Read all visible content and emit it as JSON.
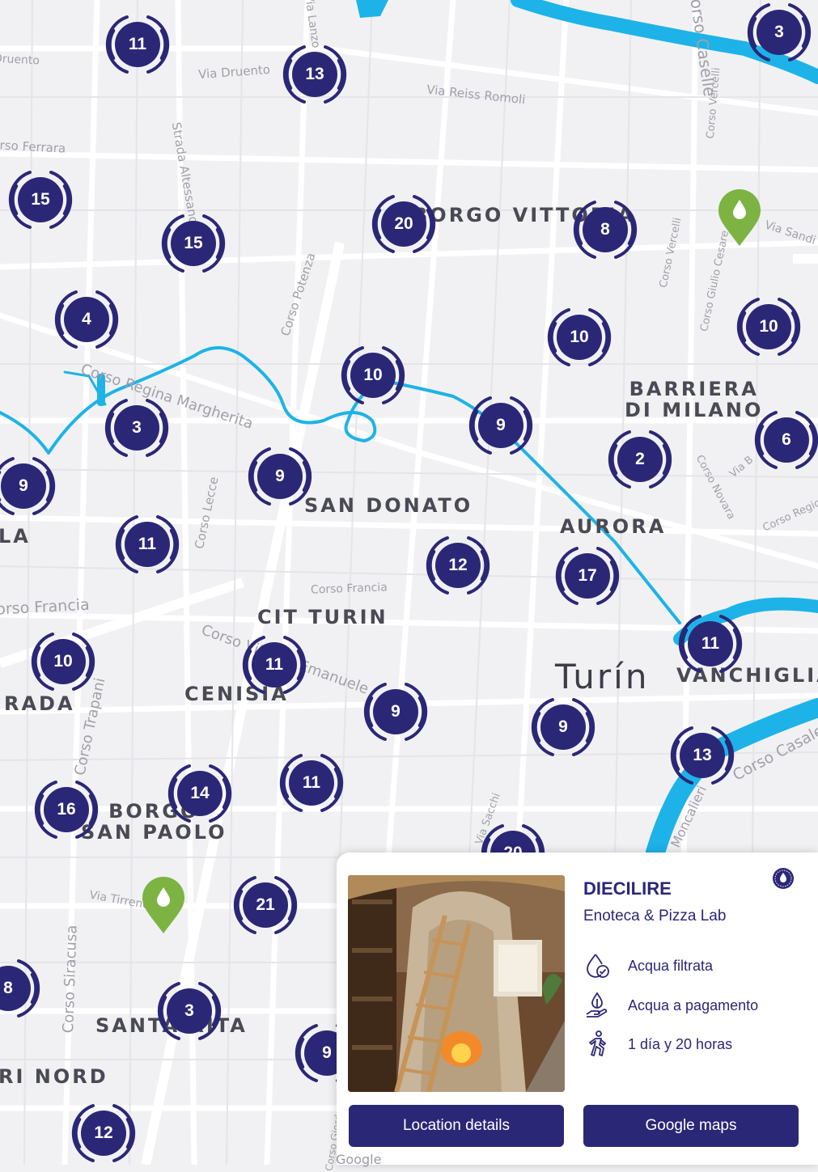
{
  "city_label": "Turín",
  "district_labels": [
    "BORGO VITTORIA",
    "BARRIERA\nDI MILANO",
    "SAN DONATO",
    "AURORA",
    "CIT TURIN",
    "CENISIA",
    "VANCHIGLIA",
    "BORGO\nSAN PAOLO",
    "SANTA RITA",
    "RADA",
    "LA",
    "RI NORD"
  ],
  "street_labels": [
    "Via Druento",
    "Via Reiss Romoli",
    "Strada Altessano",
    "Corso Ferrara",
    "Corso Potenza",
    "Corso Regina Margherita",
    "Corso Lecce",
    "Corso Francia",
    "Corso Francia",
    "Corso Vittorio Emanuele",
    "Corso Trapani",
    "Corso Vercelli",
    "Corso Vercelli",
    "Corso Giulio Cesare",
    "Via Sandi",
    "Corso Novara",
    "Via B",
    "Corso Regio",
    "Corso Casale",
    "Moncalieri",
    "Via Tirreno",
    "Corso Siracusa",
    "Via Sacchi",
    "Corso Caselle",
    "Via Lanzo",
    "Druento",
    "Corso Giordano"
  ],
  "clusters": [
    "11",
    "13",
    "3",
    "15",
    "15",
    "20",
    "8",
    "4",
    "10",
    "10",
    "10",
    "3",
    "9",
    "9",
    "2",
    "6",
    "9",
    "9",
    "11",
    "12",
    "17",
    "11",
    "10",
    "11",
    "9",
    "13",
    "16",
    "14",
    "11",
    "21",
    "8",
    "3",
    "9",
    "12",
    "20"
  ],
  "location_card": {
    "title": "DIECILIRE",
    "subtitle": "Enoteca & Pizza Lab",
    "features": [
      {
        "icon": "water-drop-check-icon",
        "label": "Acqua filtrata"
      },
      {
        "icon": "hand-coin-drop-icon",
        "label": "Acqua a pagamento"
      },
      {
        "icon": "walking-person-icon",
        "label": "1 día y 20 horas"
      }
    ],
    "details_button": "Location details",
    "maps_button": "Google maps"
  },
  "map_attribution": "Google",
  "colors": {
    "brand": "#2b2777",
    "water": "#1db3e8",
    "pin": "#7cb342",
    "map_bg": "#f1f1f3"
  }
}
